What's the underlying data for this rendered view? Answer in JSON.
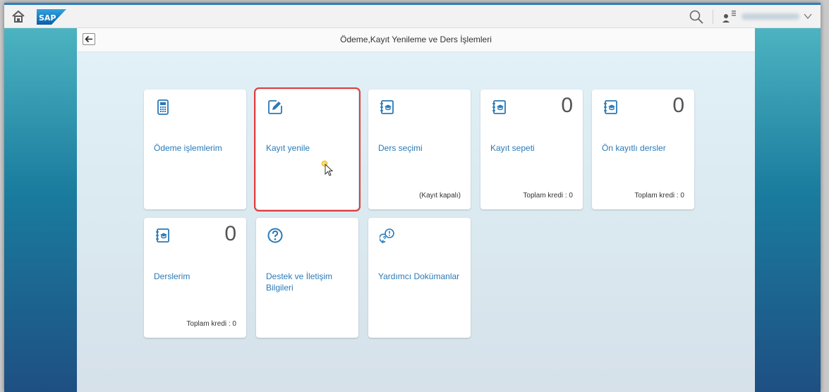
{
  "colors": {
    "accent": "#2a7ab8",
    "selection": "#e03b3b",
    "topbar_border": "#2b7fc0"
  },
  "shell": {
    "title": "Ödeme,Kayıt Yenileme ve Ders İşlemleri"
  },
  "header": {
    "icons": [
      "home-icon",
      "sap-logo",
      "search-icon",
      "user-icon",
      "chevron-down-icon"
    ]
  },
  "tiles": [
    {
      "title": "Ödeme işlemlerim",
      "icon": "calculator-icon",
      "count": "",
      "footer": ""
    },
    {
      "title": "Kayıt yenile",
      "icon": "edit-icon",
      "count": "",
      "footer": "",
      "selected": true
    },
    {
      "title": "Ders seçimi",
      "icon": "course-book-icon",
      "count": "",
      "footer": "(Kayıt kapalı)"
    },
    {
      "title": "Kayıt sepeti",
      "icon": "course-book-icon",
      "count": "0",
      "footer": "Toplam kredi : 0"
    },
    {
      "title": "Ön kayıtlı dersler",
      "icon": "course-book-icon",
      "count": "0",
      "footer": "Toplam kredi : 0"
    },
    {
      "title": "Derslerim",
      "icon": "course-book-icon",
      "count": "0",
      "footer": "Toplam kredi : 0"
    },
    {
      "title": "Destek ve İletişim Bilgileri",
      "icon": "question-icon",
      "count": "",
      "footer": ""
    },
    {
      "title": "Yardımcı Dokümanlar",
      "icon": "discussion-icon",
      "count": "",
      "footer": ""
    }
  ]
}
